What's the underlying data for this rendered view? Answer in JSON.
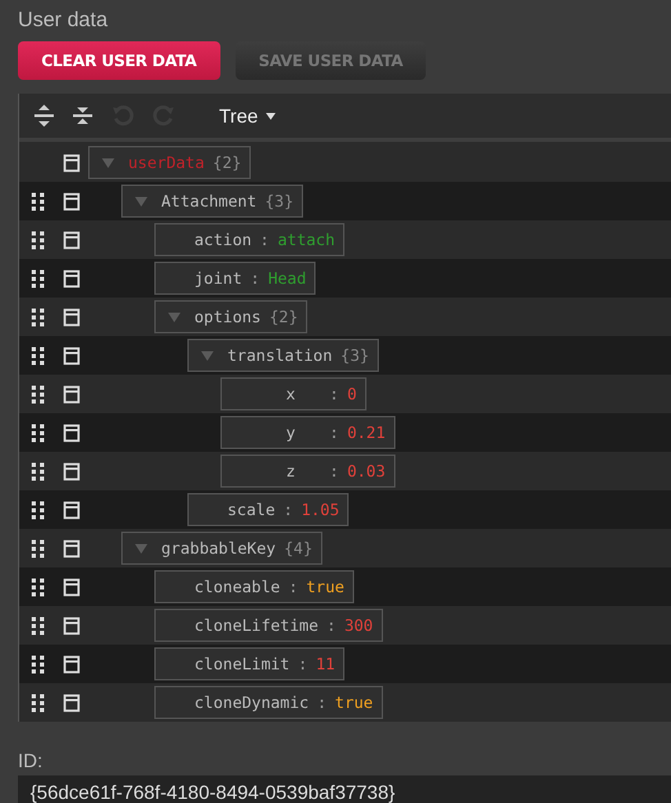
{
  "section_title": "User data",
  "buttons": [
    {
      "label": "CLEAR USER DATA",
      "kind": "primary",
      "disabled": false
    },
    {
      "label": "SAVE USER DATA",
      "kind": "secondary",
      "disabled": true
    }
  ],
  "toolbar": {
    "tools": [
      {
        "kind": "expand-all",
        "disabled": false
      },
      {
        "kind": "collapse-all",
        "disabled": false
      },
      {
        "kind": "undo",
        "disabled": true
      },
      {
        "kind": "redo",
        "disabled": true
      }
    ],
    "mode": "Tree"
  },
  "tree": {
    "key": "userData",
    "kind": "object",
    "count": "{2}",
    "expanded": true,
    "children": [
      {
        "key": "Attachment",
        "kind": "object",
        "count": "{3}",
        "expanded": true,
        "children": [
          {
            "key": "action",
            "kind": "string",
            "separator": ":",
            "value": "attach"
          },
          {
            "key": "joint",
            "kind": "string",
            "separator": ":",
            "value": "Head"
          },
          {
            "key": "options",
            "kind": "object",
            "count": "{2}",
            "expanded": true,
            "children": [
              {
                "key": "translation",
                "kind": "object",
                "count": "{3}",
                "expanded": true,
                "children": [
                  {
                    "key": "x",
                    "kind": "number",
                    "separator": ":",
                    "value": "0"
                  },
                  {
                    "key": "y",
                    "kind": "number",
                    "separator": ":",
                    "value": "0.21"
                  },
                  {
                    "key": "z",
                    "kind": "number",
                    "separator": ":",
                    "value": "0.03"
                  }
                ]
              },
              {
                "key": "scale",
                "kind": "number",
                "separator": ":",
                "value": "1.05"
              }
            ]
          }
        ]
      },
      {
        "key": "grabbableKey",
        "kind": "object",
        "count": "{4}",
        "expanded": true,
        "children": [
          {
            "key": "cloneable",
            "kind": "boolean",
            "separator": ":",
            "value": "true"
          },
          {
            "key": "cloneLifetime",
            "kind": "number",
            "separator": ":",
            "value": "300"
          },
          {
            "key": "cloneLimit",
            "kind": "number",
            "separator": ":",
            "value": "11"
          },
          {
            "key": "cloneDynamic",
            "kind": "boolean",
            "separator": ":",
            "value": "true"
          }
        ]
      }
    ]
  },
  "id_label": "ID:",
  "id_value": "{56dce61f-768f-4180-8494-0539baf37738}"
}
